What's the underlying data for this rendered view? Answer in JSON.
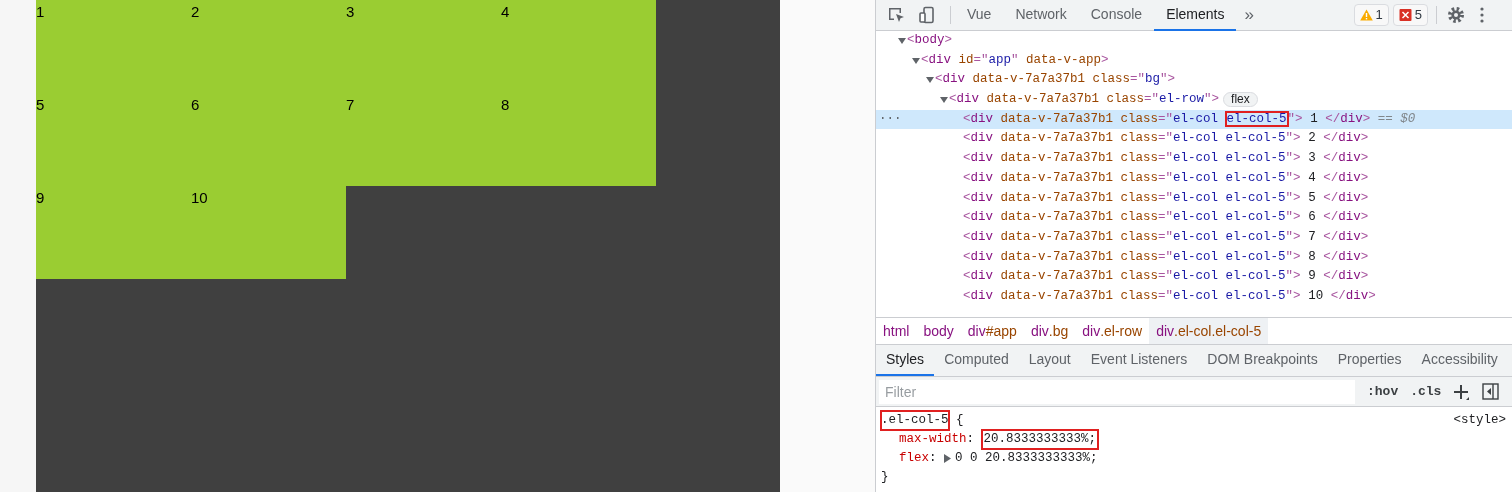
{
  "preview": {
    "cells": [
      "1",
      "2",
      "3",
      "4",
      "5",
      "6",
      "7",
      "8",
      "9",
      "10"
    ]
  },
  "devtools": {
    "toolbar": {
      "tabs": [
        {
          "label": "Vue",
          "selected": false
        },
        {
          "label": "Network",
          "selected": false
        },
        {
          "label": "Console",
          "selected": false
        },
        {
          "label": "Elements",
          "selected": true
        }
      ],
      "more": "»",
      "warnings": "1",
      "errors": "5"
    },
    "tree": {
      "selected_marker": "···",
      "nodes": [
        {
          "tokens": [
            {
              "kind": "punct",
              "text": "<"
            },
            {
              "kind": "tag",
              "text": "body"
            },
            {
              "kind": "punct",
              "text": ">"
            }
          ],
          "expanded": true,
          "selected": false,
          "children": [
            {
              "tokens": [
                {
                  "kind": "punct",
                  "text": "<"
                },
                {
                  "kind": "tag",
                  "text": "div"
                },
                {
                  "kind": "attr",
                  "text": " id"
                },
                {
                  "kind": "punct",
                  "text": "=\""
                },
                {
                  "kind": "value",
                  "text": "app"
                },
                {
                  "kind": "punct",
                  "text": "\""
                },
                {
                  "kind": "attr",
                  "text": " data-v-app"
                },
                {
                  "kind": "punct",
                  "text": ">"
                }
              ],
              "expanded": true,
              "selected": false,
              "children": [
                {
                  "tokens": [
                    {
                      "kind": "punct",
                      "text": "<"
                    },
                    {
                      "kind": "tag",
                      "text": "div"
                    },
                    {
                      "kind": "attr",
                      "text": " data-v-7a7a37b1 class"
                    },
                    {
                      "kind": "punct",
                      "text": "=\""
                    },
                    {
                      "kind": "value",
                      "text": "bg"
                    },
                    {
                      "kind": "punct",
                      "text": "\">"
                    }
                  ],
                  "expanded": true,
                  "selected": false,
                  "children": [
                    {
                      "tokens": [
                        {
                          "kind": "punct",
                          "text": "<"
                        },
                        {
                          "kind": "tag",
                          "text": "div"
                        },
                        {
                          "kind": "attr",
                          "text": " data-v-7a7a37b1 class"
                        },
                        {
                          "kind": "punct",
                          "text": "=\""
                        },
                        {
                          "kind": "value",
                          "text": "el-row"
                        },
                        {
                          "kind": "punct",
                          "text": "\">"
                        }
                      ],
                      "badge": "flex",
                      "expanded": true,
                      "selected": false,
                      "children": [
                        {
                          "tokens": [
                            {
                              "kind": "punct",
                              "text": "<"
                            },
                            {
                              "kind": "tag",
                              "text": "div"
                            },
                            {
                              "kind": "attr",
                              "text": " data-v-7a7a37b1 class"
                            },
                            {
                              "kind": "punct",
                              "text": "=\""
                            },
                            {
                              "kind": "value",
                              "text": "el-col "
                            },
                            {
                              "kind": "boxed",
                              "text": "el-col-5"
                            },
                            {
                              "kind": "punct",
                              "text": "\">"
                            },
                            {
                              "kind": "text",
                              "text": " 1 "
                            },
                            {
                              "kind": "punct",
                              "text": "</"
                            },
                            {
                              "kind": "tag",
                              "text": "div"
                            },
                            {
                              "kind": "punct",
                              "text": ">"
                            },
                            {
                              "kind": "suffix",
                              "text": " == $0"
                            }
                          ],
                          "selected": true
                        },
                        {
                          "tokens": [
                            {
                              "kind": "punct",
                              "text": "<"
                            },
                            {
                              "kind": "tag",
                              "text": "div"
                            },
                            {
                              "kind": "attr",
                              "text": " data-v-7a7a37b1 class"
                            },
                            {
                              "kind": "punct",
                              "text": "=\""
                            },
                            {
                              "kind": "value",
                              "text": "el-col el-col-5"
                            },
                            {
                              "kind": "punct",
                              "text": "\">"
                            },
                            {
                              "kind": "text",
                              "text": " 2 "
                            },
                            {
                              "kind": "punct",
                              "text": "</"
                            },
                            {
                              "kind": "tag",
                              "text": "div"
                            },
                            {
                              "kind": "punct",
                              "text": ">"
                            }
                          ],
                          "selected": false
                        },
                        {
                          "tokens": [
                            {
                              "kind": "punct",
                              "text": "<"
                            },
                            {
                              "kind": "tag",
                              "text": "div"
                            },
                            {
                              "kind": "attr",
                              "text": " data-v-7a7a37b1 class"
                            },
                            {
                              "kind": "punct",
                              "text": "=\""
                            },
                            {
                              "kind": "value",
                              "text": "el-col el-col-5"
                            },
                            {
                              "kind": "punct",
                              "text": "\">"
                            },
                            {
                              "kind": "text",
                              "text": " 3 "
                            },
                            {
                              "kind": "punct",
                              "text": "</"
                            },
                            {
                              "kind": "tag",
                              "text": "div"
                            },
                            {
                              "kind": "punct",
                              "text": ">"
                            }
                          ],
                          "selected": false
                        },
                        {
                          "tokens": [
                            {
                              "kind": "punct",
                              "text": "<"
                            },
                            {
                              "kind": "tag",
                              "text": "div"
                            },
                            {
                              "kind": "attr",
                              "text": " data-v-7a7a37b1 class"
                            },
                            {
                              "kind": "punct",
                              "text": "=\""
                            },
                            {
                              "kind": "value",
                              "text": "el-col el-col-5"
                            },
                            {
                              "kind": "punct",
                              "text": "\">"
                            },
                            {
                              "kind": "text",
                              "text": " 4 "
                            },
                            {
                              "kind": "punct",
                              "text": "</"
                            },
                            {
                              "kind": "tag",
                              "text": "div"
                            },
                            {
                              "kind": "punct",
                              "text": ">"
                            }
                          ],
                          "selected": false
                        },
                        {
                          "tokens": [
                            {
                              "kind": "punct",
                              "text": "<"
                            },
                            {
                              "kind": "tag",
                              "text": "div"
                            },
                            {
                              "kind": "attr",
                              "text": " data-v-7a7a37b1 class"
                            },
                            {
                              "kind": "punct",
                              "text": "=\""
                            },
                            {
                              "kind": "value",
                              "text": "el-col el-col-5"
                            },
                            {
                              "kind": "punct",
                              "text": "\">"
                            },
                            {
                              "kind": "text",
                              "text": " 5 "
                            },
                            {
                              "kind": "punct",
                              "text": "</"
                            },
                            {
                              "kind": "tag",
                              "text": "div"
                            },
                            {
                              "kind": "punct",
                              "text": ">"
                            }
                          ],
                          "selected": false
                        },
                        {
                          "tokens": [
                            {
                              "kind": "punct",
                              "text": "<"
                            },
                            {
                              "kind": "tag",
                              "text": "div"
                            },
                            {
                              "kind": "attr",
                              "text": " data-v-7a7a37b1 class"
                            },
                            {
                              "kind": "punct",
                              "text": "=\""
                            },
                            {
                              "kind": "value",
                              "text": "el-col el-col-5"
                            },
                            {
                              "kind": "punct",
                              "text": "\">"
                            },
                            {
                              "kind": "text",
                              "text": " 6 "
                            },
                            {
                              "kind": "punct",
                              "text": "</"
                            },
                            {
                              "kind": "tag",
                              "text": "div"
                            },
                            {
                              "kind": "punct",
                              "text": ">"
                            }
                          ],
                          "selected": false
                        },
                        {
                          "tokens": [
                            {
                              "kind": "punct",
                              "text": "<"
                            },
                            {
                              "kind": "tag",
                              "text": "div"
                            },
                            {
                              "kind": "attr",
                              "text": " data-v-7a7a37b1 class"
                            },
                            {
                              "kind": "punct",
                              "text": "=\""
                            },
                            {
                              "kind": "value",
                              "text": "el-col el-col-5"
                            },
                            {
                              "kind": "punct",
                              "text": "\">"
                            },
                            {
                              "kind": "text",
                              "text": " 7 "
                            },
                            {
                              "kind": "punct",
                              "text": "</"
                            },
                            {
                              "kind": "tag",
                              "text": "div"
                            },
                            {
                              "kind": "punct",
                              "text": ">"
                            }
                          ],
                          "selected": false
                        },
                        {
                          "tokens": [
                            {
                              "kind": "punct",
                              "text": "<"
                            },
                            {
                              "kind": "tag",
                              "text": "div"
                            },
                            {
                              "kind": "attr",
                              "text": " data-v-7a7a37b1 class"
                            },
                            {
                              "kind": "punct",
                              "text": "=\""
                            },
                            {
                              "kind": "value",
                              "text": "el-col el-col-5"
                            },
                            {
                              "kind": "punct",
                              "text": "\">"
                            },
                            {
                              "kind": "text",
                              "text": " 8 "
                            },
                            {
                              "kind": "punct",
                              "text": "</"
                            },
                            {
                              "kind": "tag",
                              "text": "div"
                            },
                            {
                              "kind": "punct",
                              "text": ">"
                            }
                          ],
                          "selected": false
                        },
                        {
                          "tokens": [
                            {
                              "kind": "punct",
                              "text": "<"
                            },
                            {
                              "kind": "tag",
                              "text": "div"
                            },
                            {
                              "kind": "attr",
                              "text": " data-v-7a7a37b1 class"
                            },
                            {
                              "kind": "punct",
                              "text": "=\""
                            },
                            {
                              "kind": "value",
                              "text": "el-col el-col-5"
                            },
                            {
                              "kind": "punct",
                              "text": "\">"
                            },
                            {
                              "kind": "text",
                              "text": " 9 "
                            },
                            {
                              "kind": "punct",
                              "text": "</"
                            },
                            {
                              "kind": "tag",
                              "text": "div"
                            },
                            {
                              "kind": "punct",
                              "text": ">"
                            }
                          ],
                          "selected": false
                        },
                        {
                          "tokens": [
                            {
                              "kind": "punct",
                              "text": "<"
                            },
                            {
                              "kind": "tag",
                              "text": "div"
                            },
                            {
                              "kind": "attr",
                              "text": " data-v-7a7a37b1 class"
                            },
                            {
                              "kind": "punct",
                              "text": "=\""
                            },
                            {
                              "kind": "value",
                              "text": "el-col el-col-5"
                            },
                            {
                              "kind": "punct",
                              "text": "\">"
                            },
                            {
                              "kind": "text",
                              "text": " 10 "
                            },
                            {
                              "kind": "punct",
                              "text": "</"
                            },
                            {
                              "kind": "tag",
                              "text": "div"
                            },
                            {
                              "kind": "punct",
                              "text": ">"
                            }
                          ],
                          "selected": false
                        }
                      ]
                    }
                  ]
                }
              ]
            }
          ]
        }
      ]
    },
    "breadcrumbs": [
      {
        "tag": "html",
        "selected": false
      },
      {
        "tag": "body",
        "selected": false
      },
      {
        "tag": "div",
        "rest": "#app",
        "selected": false
      },
      {
        "tag": "div",
        "rest": ".bg",
        "selected": false
      },
      {
        "tag": "div",
        "rest": ".el-row",
        "selected": false
      },
      {
        "tag": "div",
        "rest": ".el-col.el-col-5",
        "selected": true
      }
    ],
    "panel_tabs": [
      {
        "label": "Styles",
        "selected": true
      },
      {
        "label": "Computed",
        "selected": false
      },
      {
        "label": "Layout",
        "selected": false
      },
      {
        "label": "Event Listeners",
        "selected": false
      },
      {
        "label": "DOM Breakpoints",
        "selected": false
      },
      {
        "label": "Properties",
        "selected": false
      },
      {
        "label": "Accessibility",
        "selected": false
      }
    ],
    "filter": {
      "placeholder": "Filter",
      "buttons": [
        ":hov",
        ".cls"
      ]
    },
    "rule": {
      "selector": ".el-col-5",
      "selector_boxed": true,
      "open": " {",
      "source": "<style>",
      "close": "}",
      "declarations": [
        {
          "property": "max-width",
          "colon": ": ",
          "value": "20.8333333333%;",
          "boxed": true
        },
        {
          "property": "flex",
          "colon": ": ",
          "value": "0 0 20.8333333333%;",
          "boxed": false,
          "expandable": true
        }
      ]
    }
  }
}
